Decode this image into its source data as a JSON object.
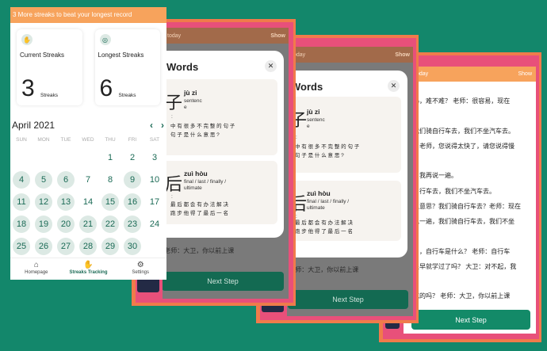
{
  "streaks": {
    "banner": "3 More streaks to beat your longest record",
    "current": {
      "label": "Current Streaks",
      "value": "3",
      "unit": "Streaks"
    },
    "longest": {
      "label": "Longest Streaks",
      "value": "6",
      "unit": "Streaks"
    },
    "month": "April 2021",
    "weekdays": [
      "SUN",
      "MON",
      "TUE",
      "WED",
      "THU",
      "FRI",
      "SAT"
    ],
    "days": [
      "1",
      "2",
      "3",
      "4",
      "5",
      "6",
      "7",
      "8",
      "9",
      "10",
      "11",
      "12",
      "13",
      "14",
      "15",
      "16",
      "17",
      "18",
      "19",
      "20",
      "21",
      "22",
      "23",
      "24",
      "25",
      "26",
      "27",
      "28",
      "29",
      "30"
    ],
    "tabs": {
      "home": "Homepage",
      "streaks": "Streaks Tracking",
      "settings": "Settings"
    }
  },
  "words_screen": {
    "bar_left": "today",
    "bar_right": "Show",
    "title": "Words",
    "close": "✕",
    "word1": {
      "hanzi": "子",
      "pinyin": "jù zi",
      "meaning": [
        "sentenc",
        "e"
      ],
      "colon": ":",
      "examples": [
        "中 有 很 多 不 完 整 的 句 子",
        "句 子 是 什 么 意 思 ?"
      ]
    },
    "word2": {
      "hanzi": "后",
      "pinyin": "zuì hòu",
      "meaning": [
        "final / last / finally /",
        "ultimate"
      ],
      "colon": ":",
      "examples": [
        "最 后 都 会 有 办 法 解 决",
        "跑 步 他 得 了 最 后 一 名"
      ]
    },
    "behind_text": "吃的吗？ 老师：大卫，你以前上课",
    "next_step": "Next Step"
  },
  "reading": {
    "bar_left": "today",
    "bar_right": "Show",
    "lines": [
      "吗，难不难？ 老师：很容易，现在",
      "",
      "我们骑自行车去，我们不坐汽车去。",
      "：老师，您说得太快了，请您说得慢",
      "",
      "：我再说一遍。",
      "自行车去，我们不坐汽车去。",
      "么意思？我们骑自行车去？老师：现在",
      "说一遍，我们骑自行车去，我们不坐",
      "",
      "了，自行车是什么？ 老师：自行车",
      "很早就学过了吗？ 大卫：对不起，我",
      "",
      "吃的吗？ 老师：大卫，你以前上课"
    ],
    "next_step": "Next Step"
  }
}
